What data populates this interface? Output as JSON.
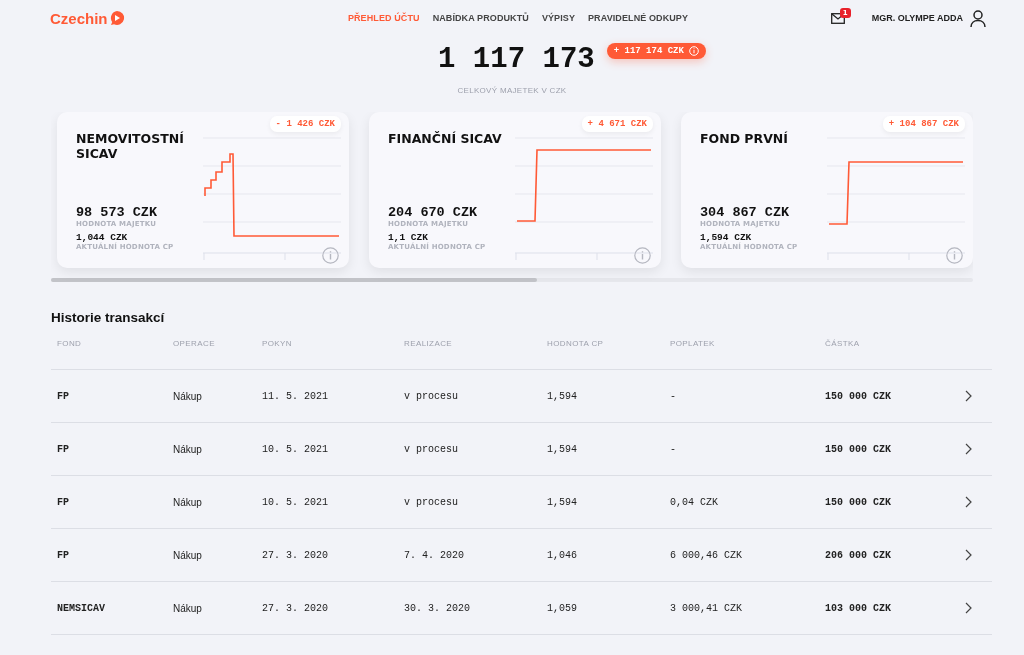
{
  "header": {
    "logo": "Czechin",
    "nav": [
      {
        "label": "PŘEHLED ÚČTU",
        "selected": true
      },
      {
        "label": "NABÍDKA PRODUKTŮ",
        "selected": false
      },
      {
        "label": "VÝPISY",
        "selected": false
      },
      {
        "label": "PRAVIDELNÉ ODKUPY",
        "selected": false
      }
    ],
    "mail_badge": "1",
    "user": "MGR. OLYMPE ADDA"
  },
  "summary": {
    "total": "1 117 173",
    "change": "+ 117 174 CZK",
    "caption": "CELKOVÝ MAJETEK V CZK"
  },
  "funds": [
    {
      "name": "NEMOVITOSTNÍ SICAV",
      "change": "- 1 426 CZK",
      "kind": "drop",
      "value": "98 573 CZK",
      "value_label": "HODNOTA MAJETKU",
      "price": "1,044 CZK",
      "price_label": "AKTUÁLNÍ HODNOTA CP"
    },
    {
      "name": "FINANČNÍ SICAV",
      "change": "+ 4 671 CZK",
      "kind": "rise",
      "value": "204 670 CZK",
      "value_label": "HODNOTA MAJETKU",
      "price": "1,1 CZK",
      "price_label": "AKTUÁLNÍ HODNOTA CP"
    },
    {
      "name": "FOND PRVNÍ",
      "change": "+ 104 867 CZK",
      "kind": "step",
      "value": "304 867 CZK",
      "value_label": "HODNOTA MAJETKU",
      "price": "1,594 CZK",
      "price_label": "AKTUÁLNÍ HODNOTA CP"
    }
  ],
  "history": {
    "title": "Historie transakcí",
    "columns": [
      "FOND",
      "OPERACE",
      "POKYN",
      "REALIZACE",
      "HODNOTA CP",
      "POPLATEK",
      "ČÁSTKA"
    ],
    "rows": [
      [
        "FP",
        "Nákup",
        "11. 5. 2021",
        "v procesu",
        "1,594",
        "-",
        "150 000 CZK"
      ],
      [
        "FP",
        "Nákup",
        "10. 5. 2021",
        "v procesu",
        "1,594",
        "-",
        "150 000 CZK"
      ],
      [
        "FP",
        "Nákup",
        "10. 5. 2021",
        "v procesu",
        "1,594",
        "0,04 CZK",
        "150 000 CZK"
      ],
      [
        "FP",
        "Nákup",
        "27. 3. 2020",
        "7. 4. 2020",
        "1,046",
        "6 000,46 CZK",
        "206 000 CZK"
      ],
      [
        "NEMSICAV",
        "Nákup",
        "27. 3. 2020",
        "30. 3. 2020",
        "1,059",
        "3 000,41 CZK",
        "103 000 CZK"
      ]
    ]
  }
}
